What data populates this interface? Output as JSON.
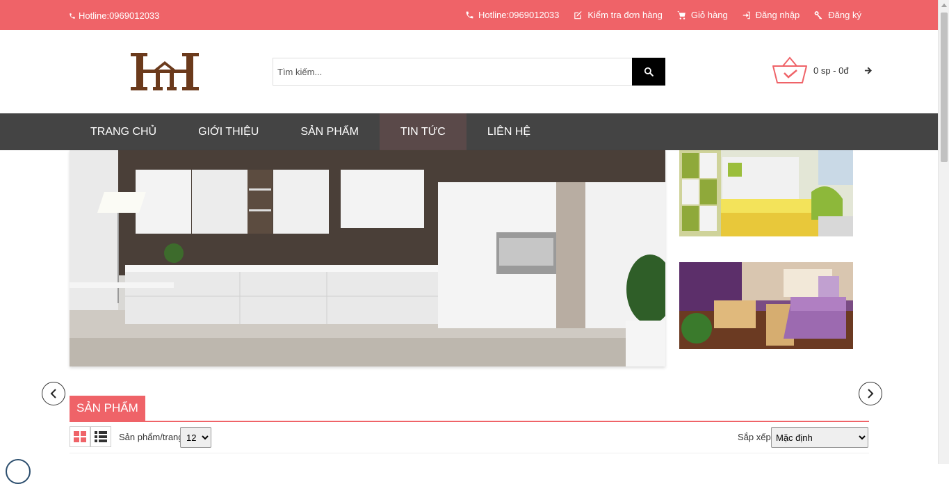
{
  "topbar": {
    "hotline_left": "Hotline:0969012033",
    "links": {
      "hotline": "Hotline:0969012033",
      "order_check": "Kiểm tra đơn hàng",
      "cart": "Giỏ hàng",
      "login": "Đăng nhập",
      "register": "Đăng ký"
    }
  },
  "search": {
    "placeholder": "Tìm kiếm..."
  },
  "cart": {
    "summary": "0 sp - 0đ"
  },
  "nav": {
    "items": [
      "TRANG CHỦ",
      "GIỚI THIỆU",
      "SẢN PHẨM",
      "TIN TỨC",
      "LIÊN HỆ"
    ],
    "active_index": 3
  },
  "products": {
    "section_title": "SẢN PHẨM",
    "per_page_label": "Sản phẩm/trang",
    "per_page_value": "12",
    "sort_label": "Sắp xếp",
    "sort_value": "Mặc định"
  },
  "colors": {
    "accent": "#ef6368",
    "nav_bg": "#444444",
    "nav_active": "#5a4949",
    "logo": "#6b3a1c"
  }
}
